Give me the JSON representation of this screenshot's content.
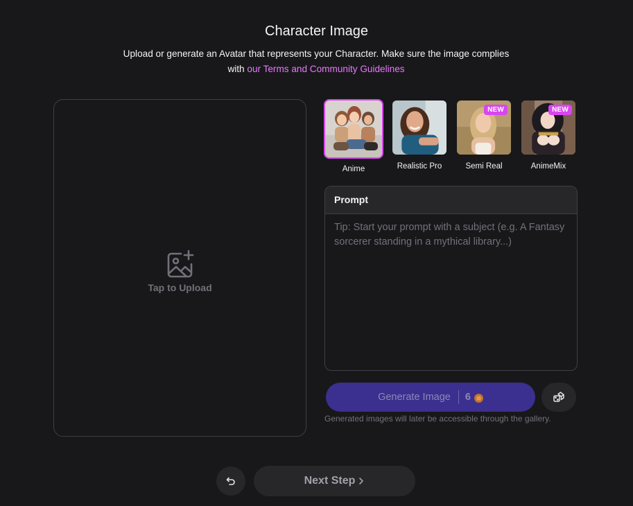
{
  "header": {
    "title": "Character Image",
    "subtitle": "Upload or generate an Avatar that represents your Character. Make sure the image complies with ",
    "terms_link": "our Terms and Community Guidelines"
  },
  "upload": {
    "label": "Tap to Upload",
    "icon": "image-plus-icon"
  },
  "styles": [
    {
      "label": "Anime",
      "selected": true,
      "badge": ""
    },
    {
      "label": "Realistic Pro",
      "selected": false,
      "badge": ""
    },
    {
      "label": "Semi Real",
      "selected": false,
      "badge": "NEW"
    },
    {
      "label": "AnimeMix",
      "selected": false,
      "badge": "NEW"
    }
  ],
  "prompt": {
    "title": "Prompt",
    "value": "",
    "placeholder": "Tip: Start your prompt with a subject (e.g. A Fantasy sorcerer standing in a mythical library...)"
  },
  "generate": {
    "label": "Generate Image",
    "cost": "6",
    "note": "Generated images will later be accessible through the gallery."
  },
  "footer": {
    "next_label": "Next Step"
  },
  "colors": {
    "background": "#18181b",
    "accent": "#d946ef",
    "generate_button": "#3b308f"
  }
}
